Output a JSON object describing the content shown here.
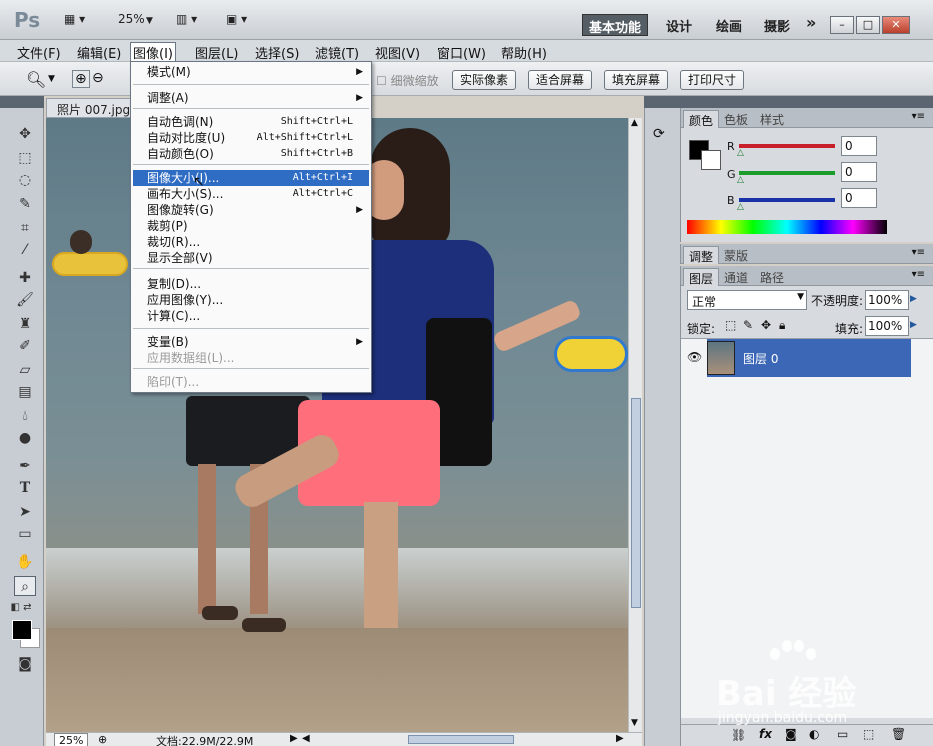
{
  "app": {
    "logo": "Ps",
    "zoom_select": "25%",
    "workspaces": [
      "基本功能",
      "设计",
      "绘画",
      "摄影"
    ],
    "more": "»"
  },
  "menubar": {
    "items": [
      "文件(F)",
      "编辑(E)",
      "图像(I)",
      "图层(L)",
      "选择(S)",
      "滤镜(T)",
      "视图(V)",
      "窗口(W)",
      "帮助(H)"
    ]
  },
  "options": {
    "scrubby_zoom": "细微缩放",
    "buttons": [
      "实际像素",
      "适合屏幕",
      "填充屏幕",
      "打印尺寸"
    ]
  },
  "document": {
    "tab_title": "照片 007.jpg",
    "zoom": "25%",
    "status": "文档:22.9M/22.9M"
  },
  "image_menu": {
    "items": [
      {
        "label": "模式(M)",
        "shortcut": "",
        "submenu": true,
        "disabled": false
      },
      {
        "label": "调整(A)",
        "shortcut": "",
        "submenu": true,
        "disabled": false
      },
      {
        "label": "自动色调(N)",
        "shortcut": "Shift+Ctrl+L",
        "submenu": false,
        "disabled": false
      },
      {
        "label": "自动对比度(U)",
        "shortcut": "Alt+Shift+Ctrl+L",
        "submenu": false,
        "disabled": false
      },
      {
        "label": "自动颜色(O)",
        "shortcut": "Shift+Ctrl+B",
        "submenu": false,
        "disabled": false
      },
      {
        "label": "图像大小(I)...",
        "shortcut": "Alt+Ctrl+I",
        "submenu": false,
        "disabled": false,
        "highlighted": true
      },
      {
        "label": "画布大小(S)...",
        "shortcut": "Alt+Ctrl+C",
        "submenu": false,
        "disabled": false
      },
      {
        "label": "图像旋转(G)",
        "shortcut": "",
        "submenu": true,
        "disabled": false
      },
      {
        "label": "裁剪(P)",
        "shortcut": "",
        "submenu": false,
        "disabled": false
      },
      {
        "label": "裁切(R)...",
        "shortcut": "",
        "submenu": false,
        "disabled": false
      },
      {
        "label": "显示全部(V)",
        "shortcut": "",
        "submenu": false,
        "disabled": false
      },
      {
        "label": "复制(D)...",
        "shortcut": "",
        "submenu": false,
        "disabled": false
      },
      {
        "label": "应用图像(Y)...",
        "shortcut": "",
        "submenu": false,
        "disabled": false
      },
      {
        "label": "计算(C)...",
        "shortcut": "",
        "submenu": false,
        "disabled": false
      },
      {
        "label": "变量(B)",
        "shortcut": "",
        "submenu": true,
        "disabled": false
      },
      {
        "label": "应用数据组(L)...",
        "shortcut": "",
        "submenu": false,
        "disabled": true
      },
      {
        "label": "陷印(T)...",
        "shortcut": "",
        "submenu": false,
        "disabled": true
      }
    ]
  },
  "color_panel": {
    "tabs": [
      "颜色",
      "色板",
      "样式"
    ],
    "channels": [
      {
        "label": "R",
        "value": "0",
        "color": "#c8202a"
      },
      {
        "label": "G",
        "value": "0",
        "color": "#1c9c2a"
      },
      {
        "label": "B",
        "value": "0",
        "color": "#1a32a8"
      }
    ]
  },
  "adjust_panel": {
    "tabs": [
      "调整",
      "蒙版"
    ]
  },
  "layers_panel": {
    "tabs": [
      "图层",
      "通道",
      "路径"
    ],
    "blend_mode": "正常",
    "opacity_label": "不透明度:",
    "opacity": "100%",
    "lock_label": "锁定:",
    "fill_label": "填充:",
    "fill": "100%",
    "layers": [
      {
        "name": "图层 0",
        "selected": true
      }
    ]
  },
  "watermark": {
    "text": "Bai 经验",
    "url": "jingyan.baidu.com"
  }
}
